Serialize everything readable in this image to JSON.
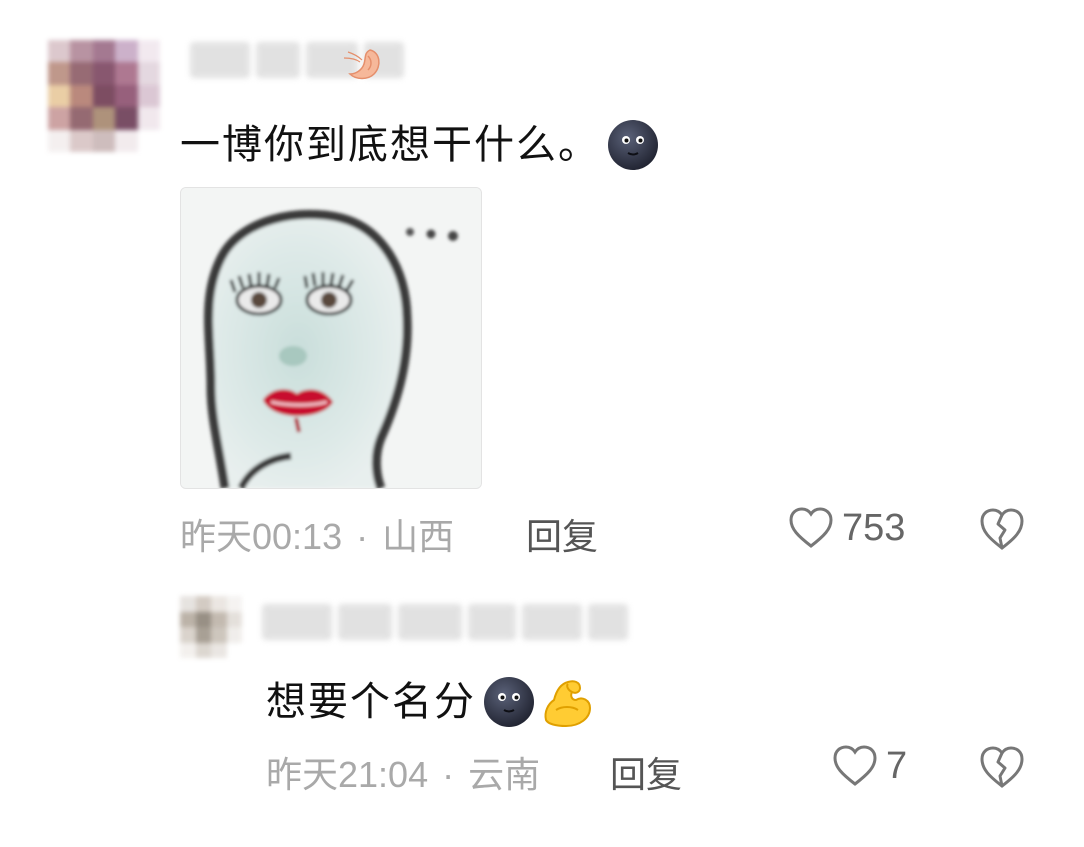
{
  "comments": [
    {
      "text": "一博你到底想干什么。",
      "emoji": "dark-face-emoji",
      "meta": {
        "time": "昨天00:13",
        "separator": "·",
        "location": "山西"
      },
      "reply_label": "回复",
      "likes": "753",
      "image": "lipstick-face-meme"
    },
    {
      "text": "想要个名分",
      "emoji": [
        "dark-face-emoji",
        "flexed-biceps-emoji"
      ],
      "meta": {
        "time": "昨天21:04",
        "separator": "·",
        "location": "云南"
      },
      "reply_label": "回复",
      "likes": "7"
    }
  ],
  "colors": {
    "meta_text": "#a9a9a9",
    "reply_text": "#555555",
    "icon": "#777777",
    "background": "#ffffff"
  },
  "icons": [
    "heart-outline-icon",
    "broken-heart-icon",
    "shrimp-badge-icon"
  ]
}
